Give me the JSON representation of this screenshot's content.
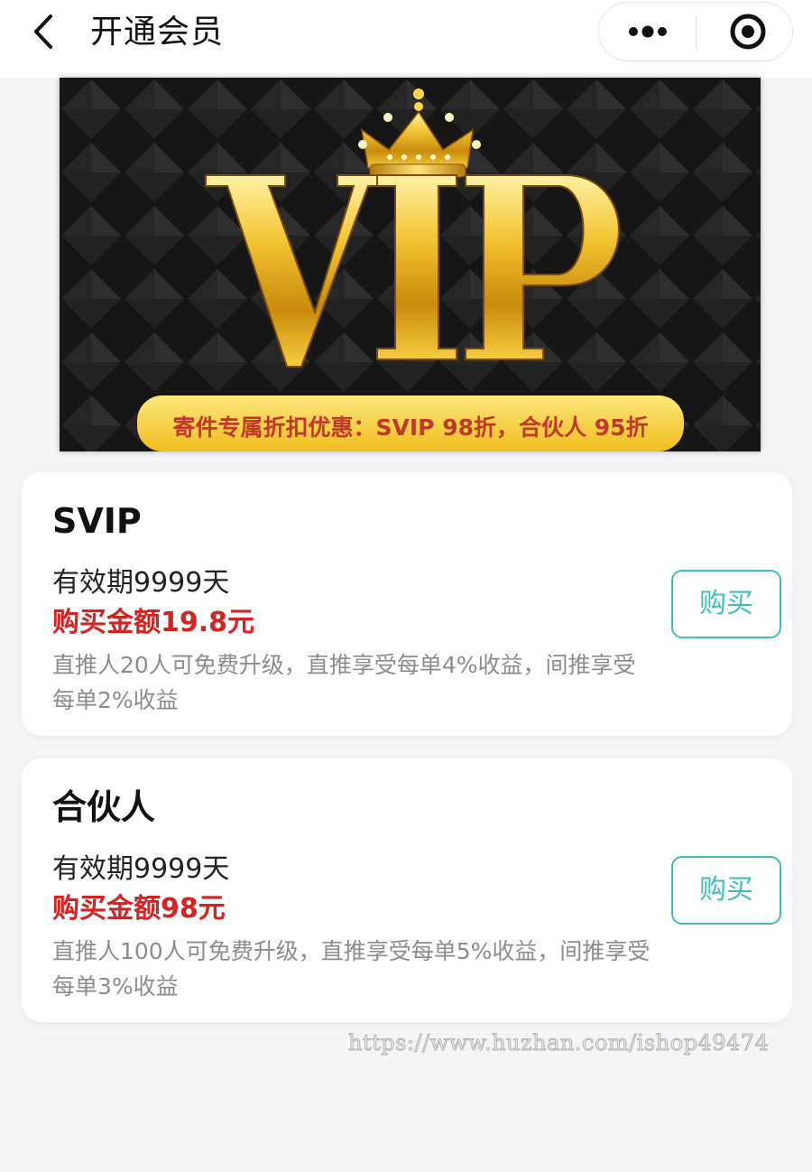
{
  "header": {
    "title": "开通会员",
    "back_icon": "chevron-left-icon",
    "more_icon": "more-dots-icon",
    "close_icon": "target-close-icon"
  },
  "banner": {
    "logo_text": "VIP",
    "promo_text": "寄件专属折扣优惠：SVIP 98折，合伙人 95折",
    "colors": {
      "background": "#151515",
      "gold": "#e8b422",
      "promo_bar": "#f5d033",
      "promo_text": "#c0392b"
    }
  },
  "plans": [
    {
      "name": "SVIP",
      "validity": "有效期9999天",
      "price": "购买金额19.8元",
      "description": "直推人20人可免费升级，直推享受每单4%收益，间推享受每单2%收益",
      "buy_label": "购买"
    },
    {
      "name": "合伙人",
      "validity": "有效期9999天",
      "price": "购买金额98元",
      "description": "直推人100人可免费升级，直推享受每单5%收益，间推享受每单3%收益",
      "buy_label": "购买"
    }
  ],
  "watermark": "https://www.huzhan.com/ishop49474",
  "colors": {
    "price_red": "#d42320",
    "accent_teal": "#3ec0b5",
    "page_bg": "#f5f5f7",
    "desc_gray": "#8c8c8c"
  }
}
